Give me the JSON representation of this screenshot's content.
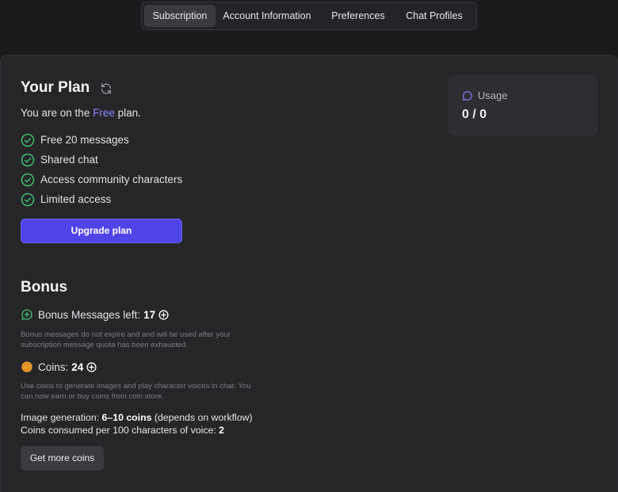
{
  "tabs": [
    {
      "label": "Subscription",
      "active": true
    },
    {
      "label": "Account Information",
      "active": false
    },
    {
      "label": "Preferences",
      "active": false
    },
    {
      "label": "Chat Profiles",
      "active": false
    }
  ],
  "plan": {
    "title": "Your Plan",
    "line_prefix": "You are on the ",
    "plan_name": "Free",
    "line_suffix": " plan.",
    "features": [
      "Free 20 messages",
      "Shared chat",
      "Access community characters",
      "Limited access"
    ],
    "upgrade_label": "Upgrade plan"
  },
  "usage": {
    "label": "Usage",
    "value": "0 / 0"
  },
  "bonus": {
    "title": "Bonus",
    "messages_label": "Bonus Messages left:",
    "messages_count": "17",
    "messages_note": "Bonus messages do not expire and and will be used after your subscription message quota has been exhausted.",
    "coins_label": "Coins:",
    "coins_count": "24",
    "coins_note": "Use coins to generate images and play character voices in chat. You can now earn or buy coins from coin store.",
    "image_gen_label": "Image generation: ",
    "image_gen_value": "6–10 coins",
    "image_gen_suffix": " (depends on workflow)",
    "voice_label": "Coins consumed per 100 characters of voice: ",
    "voice_value": "2",
    "get_coins_label": "Get more coins"
  },
  "colors": {
    "accent": "#5144e6",
    "free_link": "#8b85ff",
    "check": "#3fbf6f",
    "coin": "#f0a030"
  }
}
